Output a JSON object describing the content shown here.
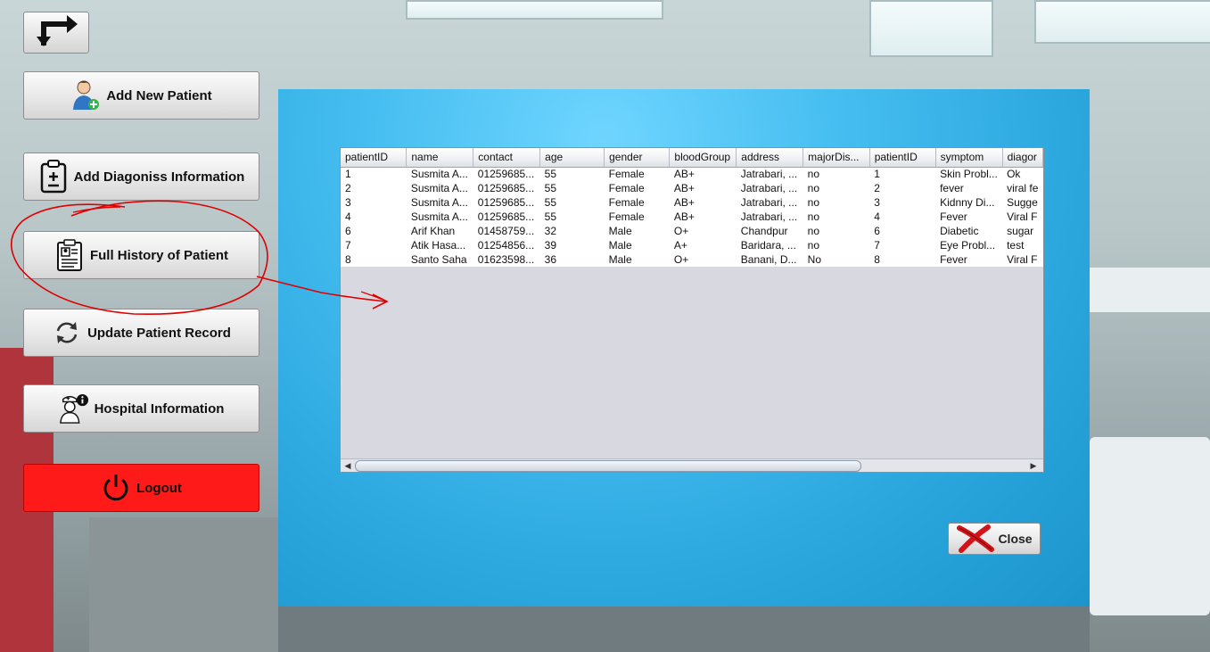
{
  "menu": {
    "add_new_patient": "Add New Patient",
    "add_diagnosis": "Add Diagoniss Information",
    "full_history": "Full History of Patient",
    "update_record": "Update Patient Record",
    "hospital_info": "Hospital Information",
    "logout": "Logout"
  },
  "icons": {
    "back": "turn-arrow-icon",
    "add_patient": "user-add-icon",
    "diagnosis": "clipboard-icon",
    "history": "patient-record-icon",
    "update": "refresh-icon",
    "hospital": "nurse-info-icon",
    "logout": "power-icon",
    "close": "red-x-icon"
  },
  "colors": {
    "logout_bg": "#ff1a1a",
    "dialog_bg": "#3db6ea",
    "annotation": "#e00000"
  },
  "table": {
    "columns": [
      "patientID",
      "name",
      "contact",
      "age",
      "gender",
      "bloodGroup",
      "address",
      "majorDis...",
      "patientID",
      "symptom",
      "diagor"
    ],
    "rows": [
      [
        "1",
        "Susmita A...",
        "01259685...",
        "55",
        "Female",
        "AB+",
        "Jatrabari, ...",
        "no",
        "1",
        "Skin Probl...",
        "Ok"
      ],
      [
        "2",
        "Susmita A...",
        "01259685...",
        "55",
        "Female",
        "AB+",
        "Jatrabari, ...",
        "no",
        "2",
        "fever",
        "viral fe"
      ],
      [
        "3",
        "Susmita A...",
        "01259685...",
        "55",
        "Female",
        "AB+",
        "Jatrabari, ...",
        "no",
        "3",
        "Kidnny Di...",
        "Sugge"
      ],
      [
        "4",
        "Susmita A...",
        "01259685...",
        "55",
        "Female",
        "AB+",
        "Jatrabari, ...",
        "no",
        "4",
        "Fever",
        "Viral F"
      ],
      [
        "6",
        "Arif Khan",
        "01458759...",
        "32",
        "Male",
        "O+",
        "Chandpur",
        "no",
        "6",
        "Diabetic",
        "sugar"
      ],
      [
        "7",
        "Atik Hasa...",
        "01254856...",
        "39",
        "Male",
        "A+",
        "Baridara, ...",
        "no",
        "7",
        "Eye Probl...",
        "test"
      ],
      [
        "8",
        "Santo Saha",
        "01623598...",
        "36",
        "Male",
        "O+",
        "Banani, D...",
        "No",
        "8",
        "Fever",
        "Viral F"
      ]
    ]
  },
  "dialog": {
    "close_label": "Close"
  }
}
